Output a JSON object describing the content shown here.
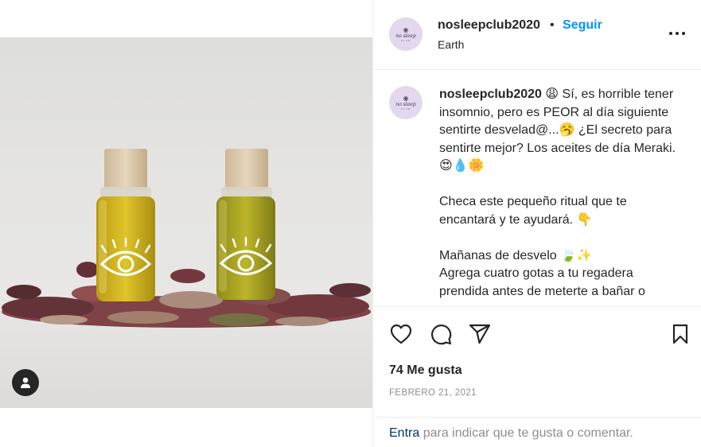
{
  "post": {
    "username": "nosleepclub2020",
    "separator": "•",
    "follow_label": "Seguir",
    "location": "Earth",
    "more_label": "•••",
    "avatar": {
      "eye": "◉",
      "brand": "no sleep",
      "sub": "CLUB"
    }
  },
  "caption": {
    "username": "nosleepclub2020",
    "lines": [
      "😩 Sí, es horrible tener insomnio, pero es PEOR al día siguiente sentirte desvelad@...🥱 ¿El secreto para sentirte mejor? Los aceites de día Meraki. 😍💧🌼",
      "Checa este pequeño ritual que te encantará y te ayudará. 👇",
      "Mañanas de desvelo 🍃✨",
      "Agrega cuatro gotas a tu regadera prendida antes de meterte a bañar o"
    ]
  },
  "actions": {
    "like_icon": "heart-icon",
    "comment_icon": "comment-icon",
    "share_icon": "share-icon",
    "save_icon": "bookmark-icon"
  },
  "likes": "74 Me gusta",
  "date": "FEBRERO 21, 2021",
  "comment": {
    "link": "Entra",
    "rest": " para indicar que te gusta o comentar."
  },
  "colors": {
    "accent": "#0095f6",
    "text": "#262626",
    "muted": "#8e8e8e",
    "link": "#00376b",
    "avatar_bg": "#e3d8ee"
  }
}
